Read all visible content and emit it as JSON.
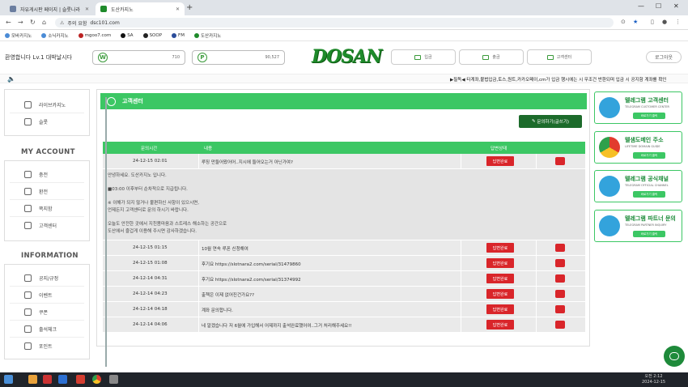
{
  "browser": {
    "tabs": [
      {
        "label": "자유게시판 페이지 | 슬롯나라"
      },
      {
        "label": "도산카지노"
      }
    ],
    "url": "dsc101.com",
    "url_warning": "주의 요함",
    "bookmarks": [
      "모바카지노",
      "소닉카지노",
      "mgoo7.com",
      "SA",
      "SOOP",
      "FM",
      "도산카지노"
    ]
  },
  "header": {
    "welcome": "환영합니다 Lv.1 대박날시다",
    "wallet": {
      "label": "W",
      "value": "710"
    },
    "point": {
      "label": "P",
      "value": "90,527"
    },
    "logo": "DOSAN",
    "buttons": [
      "입금",
      "출금",
      "고객센터"
    ],
    "login": "로그아웃"
  },
  "ticker": "▶필독◀ 타계좌,불법입금,토스,원트,카카오페이,cm가 입금 행시에는 시 무조건 반환되며 입금 시 공지함 계좌를 확인",
  "sidebar": {
    "top": [
      "라이브카지노",
      "슬롯"
    ],
    "account_title": "MY ACCOUNT",
    "account": [
      "충전",
      "환전",
      "쪽지함",
      "고객센터"
    ],
    "info_title": "INFORMATION",
    "info": [
      "공지/규정",
      "이벤트",
      "쿠폰",
      "출석체크",
      "포인트"
    ]
  },
  "main": {
    "title": "고객센터",
    "write_label": "문의하기(글쓰기)",
    "columns": [
      "문의시간",
      "내용",
      "답변상태"
    ],
    "open": {
      "date": "24-12-15 02:01",
      "title": "루징 만들어왔어어..지시에 들어오는거 아닌가여?",
      "status": "답변완료",
      "lines": [
        "안녕하세요. 도산카지노 입니다.",
        "■03:00 이후부터 순차적으로 지급됩니다.",
        "※ 이해가 되지 않거나 불편하신 사항이 있으시면,",
        "언제든지 고객센터로 문의 하시기 바랍니다.",
        "오늘도 안전한 곳에서 지친몸마음과 스트레스 해소하는 공간으로",
        "도산에서 즐겁게 이용해 주시면 감사하겠습니다."
      ]
    },
    "rows": [
      {
        "date": "24-12-15 01:15",
        "title": "10월 연속 루폰 신청해여",
        "status": "답변완료"
      },
      {
        "date": "24-12-15 01:08",
        "title": "후기요 https://slotnara2.com/serial/31479860",
        "status": "답변완료"
      },
      {
        "date": "24-12-14 04:31",
        "title": "후기요 https://slotnara2.com/serial/31374992",
        "status": "답변완료"
      },
      {
        "date": "24-12-14 04:23",
        "title": "출첵은 이제 없어진건가요??",
        "status": "답변완료"
      },
      {
        "date": "24-12-14 04:18",
        "title": "계좌 문의합니다.",
        "status": "답변완료"
      },
      {
        "date": "24-12-14 04:06",
        "title": "네 알겠습니다 저 6월에 가입해서 어제까지 출석완료했어여..그거 처리해주세요!!",
        "status": "답변완료"
      }
    ]
  },
  "right_cards": [
    {
      "title": "텔레그램 고객센터",
      "sub": "TELEGRAM CUSTOMER CENTER",
      "btn": "바로가기 클릭"
    },
    {
      "title": "텔샘도메인 주소",
      "sub": "LIFETIME DOMAIN GUIDE",
      "btn": "바로가기 클릭"
    },
    {
      "title": "텔레그램 공식채널",
      "sub": "TELEGRAM OFFICIAL CHANNEL",
      "btn": "바로가기 클릭"
    },
    {
      "title": "텔레그램 파트너 문의",
      "sub": "TELEGRAM PARTNER INQUIRY",
      "btn": "바로가기 클릭"
    }
  ],
  "taskbar": {
    "time": "오전 2:12",
    "date": "2024-12-15"
  }
}
